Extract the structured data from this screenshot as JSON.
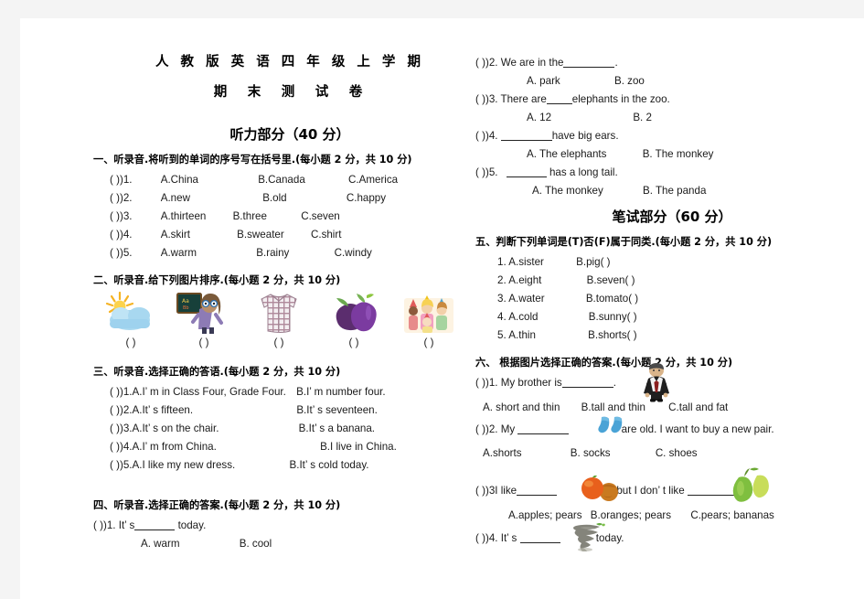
{
  "document": {
    "title_line1": "人 教 版 英 语 四 年 级 上 学 期",
    "title_line2": "期　末　测　试　卷"
  },
  "parts": {
    "listening": "听力部分（40 分）",
    "written": "笔试部分（60 分）"
  },
  "sections": {
    "s1": {
      "heading": "一、听录音.将听到的单词的序号写在括号里.(每小题 2 分，共 10 分)",
      "items": [
        {
          "num": ")1.",
          "a": "A.China",
          "b": "B.Canada",
          "c": "C.America"
        },
        {
          "num": ")2.",
          "a": "A.new",
          "b": "B.old",
          "c": "C.happy"
        },
        {
          "num": ")3.",
          "a": "A.thirteen",
          "b": "B.three",
          "c": "C.seven"
        },
        {
          "num": ")4.",
          "a": "A.skirt",
          "b": "B.sweater",
          "c": "C.shirt"
        },
        {
          "num": ")5.",
          "a": "A.warm",
          "b": "B.rainy",
          "c": "C.windy"
        }
      ]
    },
    "s2": {
      "heading": "二、听录音.给下列图片排序.(每小题 2 分，共 10 分)",
      "pictures": [
        {
          "name": "sun-cloud-weather-picture",
          "mark": "(      )"
        },
        {
          "name": "teacher-at-blackboard-picture",
          "mark": "(      )"
        },
        {
          "name": "plaid-shirt-picture",
          "mark": "(      )"
        },
        {
          "name": "eggplant-picture",
          "mark": "(      )"
        },
        {
          "name": "birthday-party-kids-picture",
          "mark": "(      )"
        }
      ]
    },
    "s3": {
      "heading": "三、听录音.选择正确的答语.(每小题 2 分，共 10 分)",
      "items": [
        {
          "num": ")1.",
          "a": "A.I’ m in Class Four, Grade Four.",
          "b": "B.I’ m number four."
        },
        {
          "num": ")2.",
          "a": "A.It’ s fifteen.",
          "b": "B.It’ s seventeen."
        },
        {
          "num": ")3.",
          "a": "A.It’ s on the chair.",
          "b": "B.It’ s a banana."
        },
        {
          "num": ")4.",
          "a": "A.I’ m from China.",
          "b": "B.I live in China."
        },
        {
          "num": ")5.",
          "a": "A.I like my new dress.",
          "b": "B.It’ s cold today."
        }
      ]
    },
    "s4": {
      "heading": "四、听录音.选择正确的答案.(每小题 2 分，共 10 分)",
      "q1": {
        "num": ")1.",
        "text_before": "It’ s",
        "text_after": "today.",
        "a": "A. warm",
        "b": "B. cool"
      },
      "q2": {
        "num": ")2.",
        "text_before": "We are in the",
        "text_after": ".",
        "a": "A. park",
        "b": "B. zoo"
      },
      "q3": {
        "num": ")3.",
        "text_before": "There are",
        "text_after": "elephants in the zoo.",
        "a": "A. 12",
        "b": "B. 2"
      },
      "q4": {
        "num": ")4.",
        "text_before": "",
        "text_after": "have big ears.",
        "a": "A. The elephants",
        "b": "B. The monkey"
      },
      "q5": {
        "num": ")5.",
        "text_before": "",
        "text_after": "has a long tail.",
        "a": "A. The monkey",
        "b": "B. The panda"
      }
    },
    "s5": {
      "heading": "五、判断下列单词是(T)否(F)属于同类.(每小题 2 分，共 10 分)",
      "items": [
        {
          "num": "1.",
          "a": "A.sister",
          "b": "B.pig(     )"
        },
        {
          "num": "2.",
          "a": "A.eight",
          "b": "B.seven(     )"
        },
        {
          "num": "3.",
          "a": "A.water",
          "b": "B.tomato(     )"
        },
        {
          "num": "4.",
          "a": "A.cold",
          "b": "B.sunny(     )"
        },
        {
          "num": "5.",
          "a": "A.thin",
          "b": "B.shorts(     )"
        }
      ]
    },
    "s6": {
      "heading": "六、 根据图片选择正确的答案.(每小题 2 分，共 10 分)",
      "q1": {
        "num": ")1.",
        "text": "My brother is",
        "tail": ".",
        "picture": "fat-businessman-picture",
        "a": "A. short and thin",
        "b": "B.tall and thin",
        "c": "C.tall and fat"
      },
      "q2": {
        "num": ")2.",
        "text_before": "My",
        "picture": "blue-socks-picture",
        "text_after": "are old. I want to buy a new pair.",
        "a": "A.shorts",
        "b": "B. socks",
        "c": "C. shoes"
      },
      "q3": {
        "num": ")3",
        "text_before": "I like",
        "picture1": "orange-fruit-picture",
        "text_middle": "but I don’ t like",
        "picture2": "pears-picture",
        "a": "A.apples; pears",
        "b": "B.oranges; pears",
        "c": "C.pears; bananas"
      },
      "q4": {
        "num": ")4.",
        "text_before": "It’ s",
        "picture": "tornado-windy-picture",
        "text_after": "today."
      }
    }
  },
  "colors": {
    "page_background": "#ffffff",
    "outer_background": "#f4f4f4",
    "text": "#1a1a1a"
  }
}
